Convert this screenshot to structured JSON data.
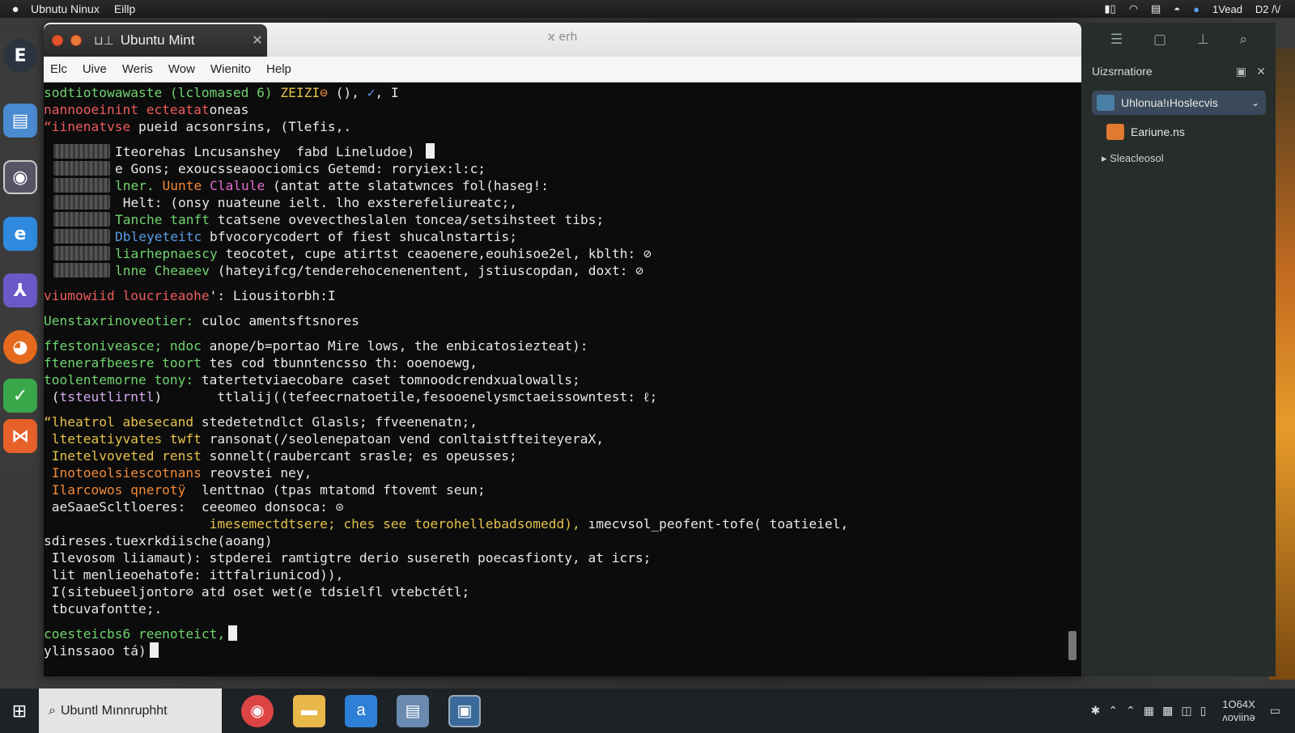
{
  "topbar": {
    "apple_icon": "apple-logo-icon",
    "menus": [
      "Ubnutu Ninux",
      "Eillp"
    ],
    "right_time": "1Vead",
    "right_date": "D2 /\\/"
  },
  "window": {
    "tab_title": "Ubuntu Mint",
    "title": "ϰ erh",
    "menus": [
      "Elc",
      "Uive",
      "Weris",
      "Wow",
      "Wienito",
      "Help"
    ]
  },
  "terminal": {
    "lines": [
      {
        "segments": [
          {
            "t": "sodtiotowawaste (lclomased 6) ",
            "c": "g"
          },
          {
            "t": "ZEIZI",
            "c": "y"
          },
          {
            "t": "⊖",
            "c": "o"
          },
          {
            "t": " (), ",
            "c": "w"
          },
          {
            "t": "✓",
            "c": "b"
          },
          {
            "t": ", I",
            "c": "w"
          }
        ]
      },
      {
        "segments": [
          {
            "t": "nannooeinint ecteatat",
            "c": "r"
          },
          {
            "t": "oneas",
            "c": "w"
          }
        ]
      },
      {
        "segments": [
          {
            "t": "“iinenatvse",
            "c": "r"
          },
          {
            "t": " pueid acsonrsins, (Tlefis,.",
            "c": "w"
          }
        ]
      },
      {
        "gap": true
      },
      {
        "block": true,
        "segments": [
          {
            "t": "Iteorehas Lncusanshey  fabd Lineludoe) ",
            "c": "w"
          }
        ],
        "cursor": true
      },
      {
        "block": true,
        "segments": [
          {
            "t": "e Gons; exoucsseaoociomics Getemd: ror",
            "c": "w"
          },
          {
            "t": "yiex:l:c;",
            "c": "w"
          }
        ]
      },
      {
        "block": true,
        "segments": [
          {
            "t": "lner. ",
            "c": "g"
          },
          {
            "t": "Uunte ",
            "c": "o"
          },
          {
            "t": "Clalule",
            "c": "m"
          },
          {
            "t": " (antat atte slatatwnces fol(haseg!:",
            "c": "w"
          }
        ]
      },
      {
        "block": true,
        "segments": [
          {
            "t": " Helt: (onsy",
            "c": "w"
          },
          {
            "t": " nuateune ielt. lho exsterefeliureatc;,",
            "c": "w"
          }
        ]
      },
      {
        "block": true,
        "segments": [
          {
            "t": "Tanche tanft",
            "c": "g"
          },
          {
            "t": " tcatsene ovevectheslalen toncea/setsihsteet tibs;",
            "c": "w"
          }
        ]
      },
      {
        "block": true,
        "segments": [
          {
            "t": "Dbleyeteitc",
            "c": "b"
          },
          {
            "t": " bfvocorycodert of fiest shucalnstartis;",
            "c": "w"
          }
        ]
      },
      {
        "block": true,
        "segments": [
          {
            "t": "liarhepnaescy",
            "c": "g"
          },
          {
            "t": " teocotet, cupe atirtst ceaoenere,eouhisoe2el, kblth: ⊘",
            "c": "w"
          }
        ]
      },
      {
        "block": true,
        "segments": [
          {
            "t": "lnne Cheaeev",
            "c": "g"
          },
          {
            "t": " (hateyifcg/tenderehocenenentent, jstiuscopdan, doxt: ⊘",
            "c": "w"
          }
        ]
      },
      {
        "gap": true
      },
      {
        "segments": [
          {
            "t": "viumowiid loucrieaohe",
            "c": "r"
          },
          {
            "t": "': Liousitorbh:",
            "c": "w"
          },
          {
            "t": "I",
            "c": "w"
          }
        ]
      },
      {
        "gap": true
      },
      {
        "segments": [
          {
            "t": "Uenstaxrinoveotier:",
            "c": "g"
          },
          {
            "t": " culoc amentsftsnores",
            "c": "w"
          }
        ]
      },
      {
        "gap": true
      },
      {
        "segments": [
          {
            "t": "ffestoniveasce; ndoc",
            "c": "g"
          },
          {
            "t": " anope/b=portao Mire lows, the enbicatosiezteat):",
            "c": "w"
          }
        ]
      },
      {
        "segments": [
          {
            "t": "ftenerafbeesre toort",
            "c": "g"
          },
          {
            "t": " tes cod tbunntencsso th: ooenoewg,",
            "c": "w"
          }
        ]
      },
      {
        "segments": [
          {
            "t": "toolentemorne tony:",
            "c": "g"
          },
          {
            "t": " tatertetviaecobare caset tomnoodcrendxualowalls;",
            "c": "w"
          }
        ]
      },
      {
        "segments": [
          {
            "t": " (",
            "c": "w"
          },
          {
            "t": "tsteutlirntl",
            "c": "c"
          },
          {
            "t": ")       ttlalij((tefeecrnatoetile,fesooenelysmctaeissowntest: ℓ;",
            "c": "w"
          }
        ]
      },
      {
        "gap": true
      },
      {
        "segments": [
          {
            "t": "“lheatrol abesecand",
            "c": "y"
          },
          {
            "t": " stedetetndlct Glasls; ffveenenatn;,",
            "c": "w"
          }
        ]
      },
      {
        "segments": [
          {
            "t": " lteteatiyvates twft",
            "c": "y"
          },
          {
            "t": " ransonat(/seolenepatoan vend conltaistfteiteyeraX,",
            "c": "w"
          }
        ]
      },
      {
        "segments": [
          {
            "t": " Inetelvoveted renst",
            "c": "y"
          },
          {
            "t": " sonnelt(raubercant srasle; es opeusses;",
            "c": "w"
          }
        ]
      },
      {
        "segments": [
          {
            "t": " Inotoeolsiescotnans",
            "c": "o"
          },
          {
            "t": " reovstei ney,",
            "c": "w"
          }
        ]
      },
      {
        "segments": [
          {
            "t": " Ilarcowos qnerotÿ",
            "c": "o"
          },
          {
            "t": "  lenttnao (tpas mtatomd ftovemt seun;",
            "c": "w"
          }
        ]
      },
      {
        "segments": [
          {
            "t": " aeSaaeScltloeres:",
            "c": "w"
          },
          {
            "t": "  ceeomeo donsoca: ⊙",
            "c": "w"
          }
        ]
      },
      {
        "segments": [
          {
            "t": "                     imesemectdtsere; ches see toerohellebadsomedd),",
            "c": "y"
          },
          {
            "t": " ımecvsol_peofent-tofe( toatieiel,",
            "c": "w"
          }
        ]
      },
      {
        "segments": [
          {
            "t": "sdireses.tuexrkdiische(aoang)",
            "c": "w"
          }
        ]
      },
      {
        "segments": [
          {
            "t": " Ilevosom liiamaut):",
            "c": "w"
          },
          {
            "t": " stpderei ramtigtre derio susereth poecasfionty, at icrs;",
            "c": "w"
          }
        ]
      },
      {
        "segments": [
          {
            "t": " lit menlieoehatofe:",
            "c": "w"
          },
          {
            "t": " ittfalriunicod)),",
            "c": "w"
          }
        ]
      },
      {
        "segments": [
          {
            "t": " I(sitebueeljontor⊘",
            "c": "w"
          },
          {
            "t": " atd oset wet(e tdsielfl vtebctétl;",
            "c": "w"
          }
        ]
      },
      {
        "segments": [
          {
            "t": " tbcuvafontte;.",
            "c": "w"
          }
        ]
      },
      {
        "gap": true
      },
      {
        "segments": [
          {
            "t": "coesteicbs6 reenoteict,",
            "c": "g"
          }
        ],
        "cursor": true
      },
      {
        "segments": [
          {
            "t": "ylinssaoo tá)",
            "c": "w"
          }
        ],
        "cursor": true
      }
    ]
  },
  "side_panel": {
    "header": "Uizsrnatiore",
    "items": [
      {
        "label": "Uhlonua!ıHoslecvis",
        "color": "#4a7fa8",
        "selected": true
      },
      {
        "label": "Eariune.ns",
        "color": "#e07a30",
        "selected": false
      }
    ],
    "section": "Sleacleosol"
  },
  "taskbar": {
    "app_label": "Ubuntl Mınnruphht",
    "clock_top": "1O64X",
    "clock_bottom": "ʌoviinə"
  },
  "colors": {
    "terminal_bg": "#0c0c0c",
    "prompt_green": "#6fd36f",
    "prompt_red": "#ef5b5b",
    "close_button": "#e2532c"
  }
}
